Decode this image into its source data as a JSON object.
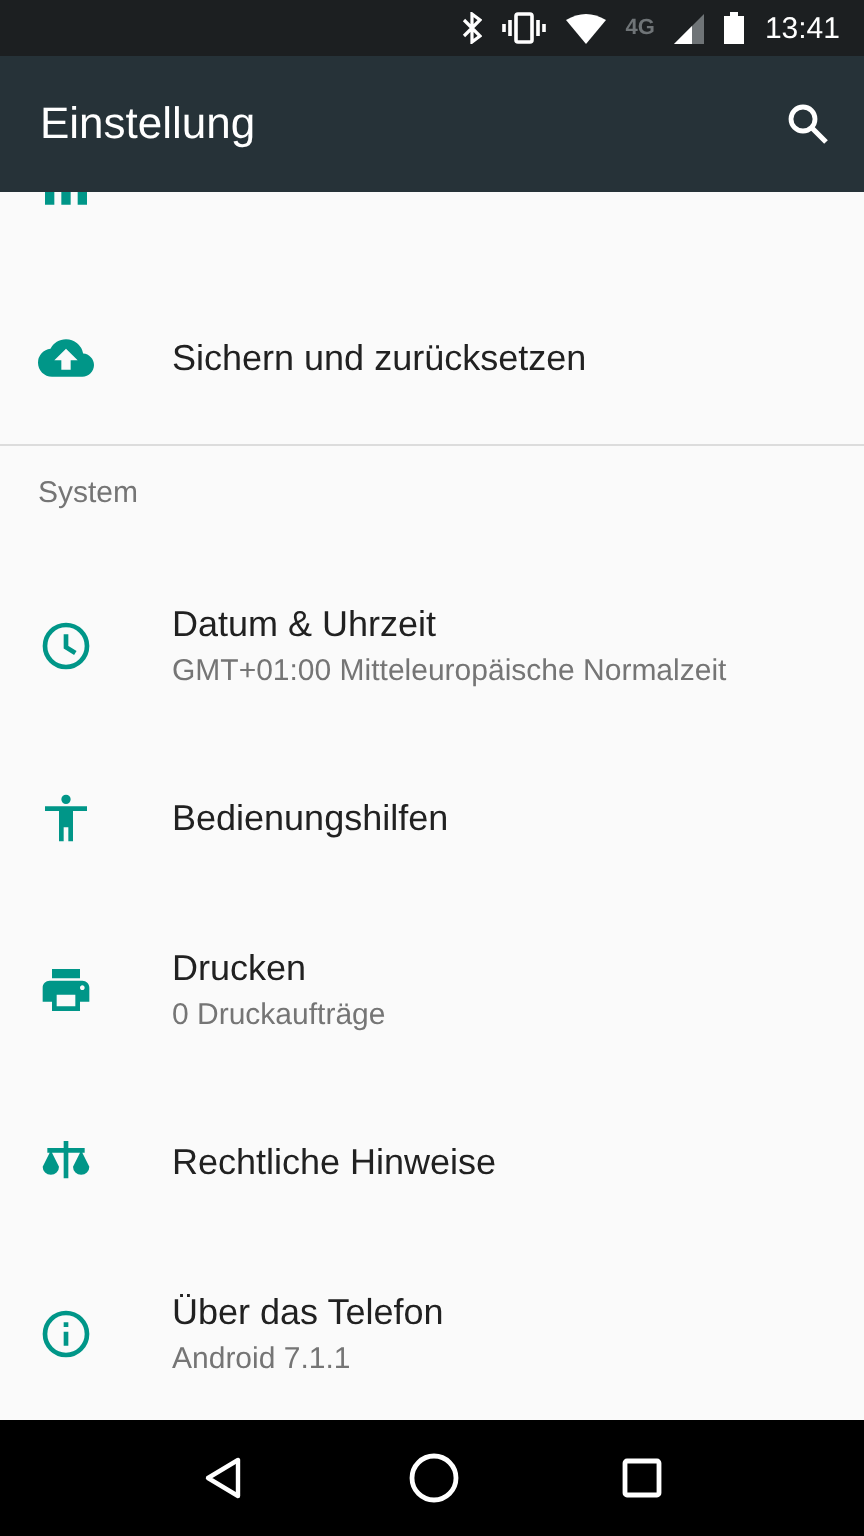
{
  "status_bar": {
    "network": "4G",
    "time": "13:41"
  },
  "app_bar": {
    "title": "Einstellung"
  },
  "sections": [
    {
      "items": [
        {
          "kind": "bars"
        },
        {
          "kind": "cloud",
          "title": "Sichern und zurücksetzen"
        }
      ]
    },
    {
      "header": "System",
      "items": [
        {
          "kind": "clock",
          "title": "Datum & Uhrzeit",
          "subtitle": "GMT+01:00 Mitteleuropäische Normalzeit"
        },
        {
          "kind": "person",
          "title": "Bedienungshilfen"
        },
        {
          "kind": "printer",
          "title": "Drucken",
          "subtitle": "0 Druckaufträge"
        },
        {
          "kind": "scales",
          "title": "Rechtliche Hinweise"
        },
        {
          "kind": "info",
          "title": "Über das Telefon",
          "subtitle": "Android 7.1.1"
        }
      ]
    }
  ]
}
